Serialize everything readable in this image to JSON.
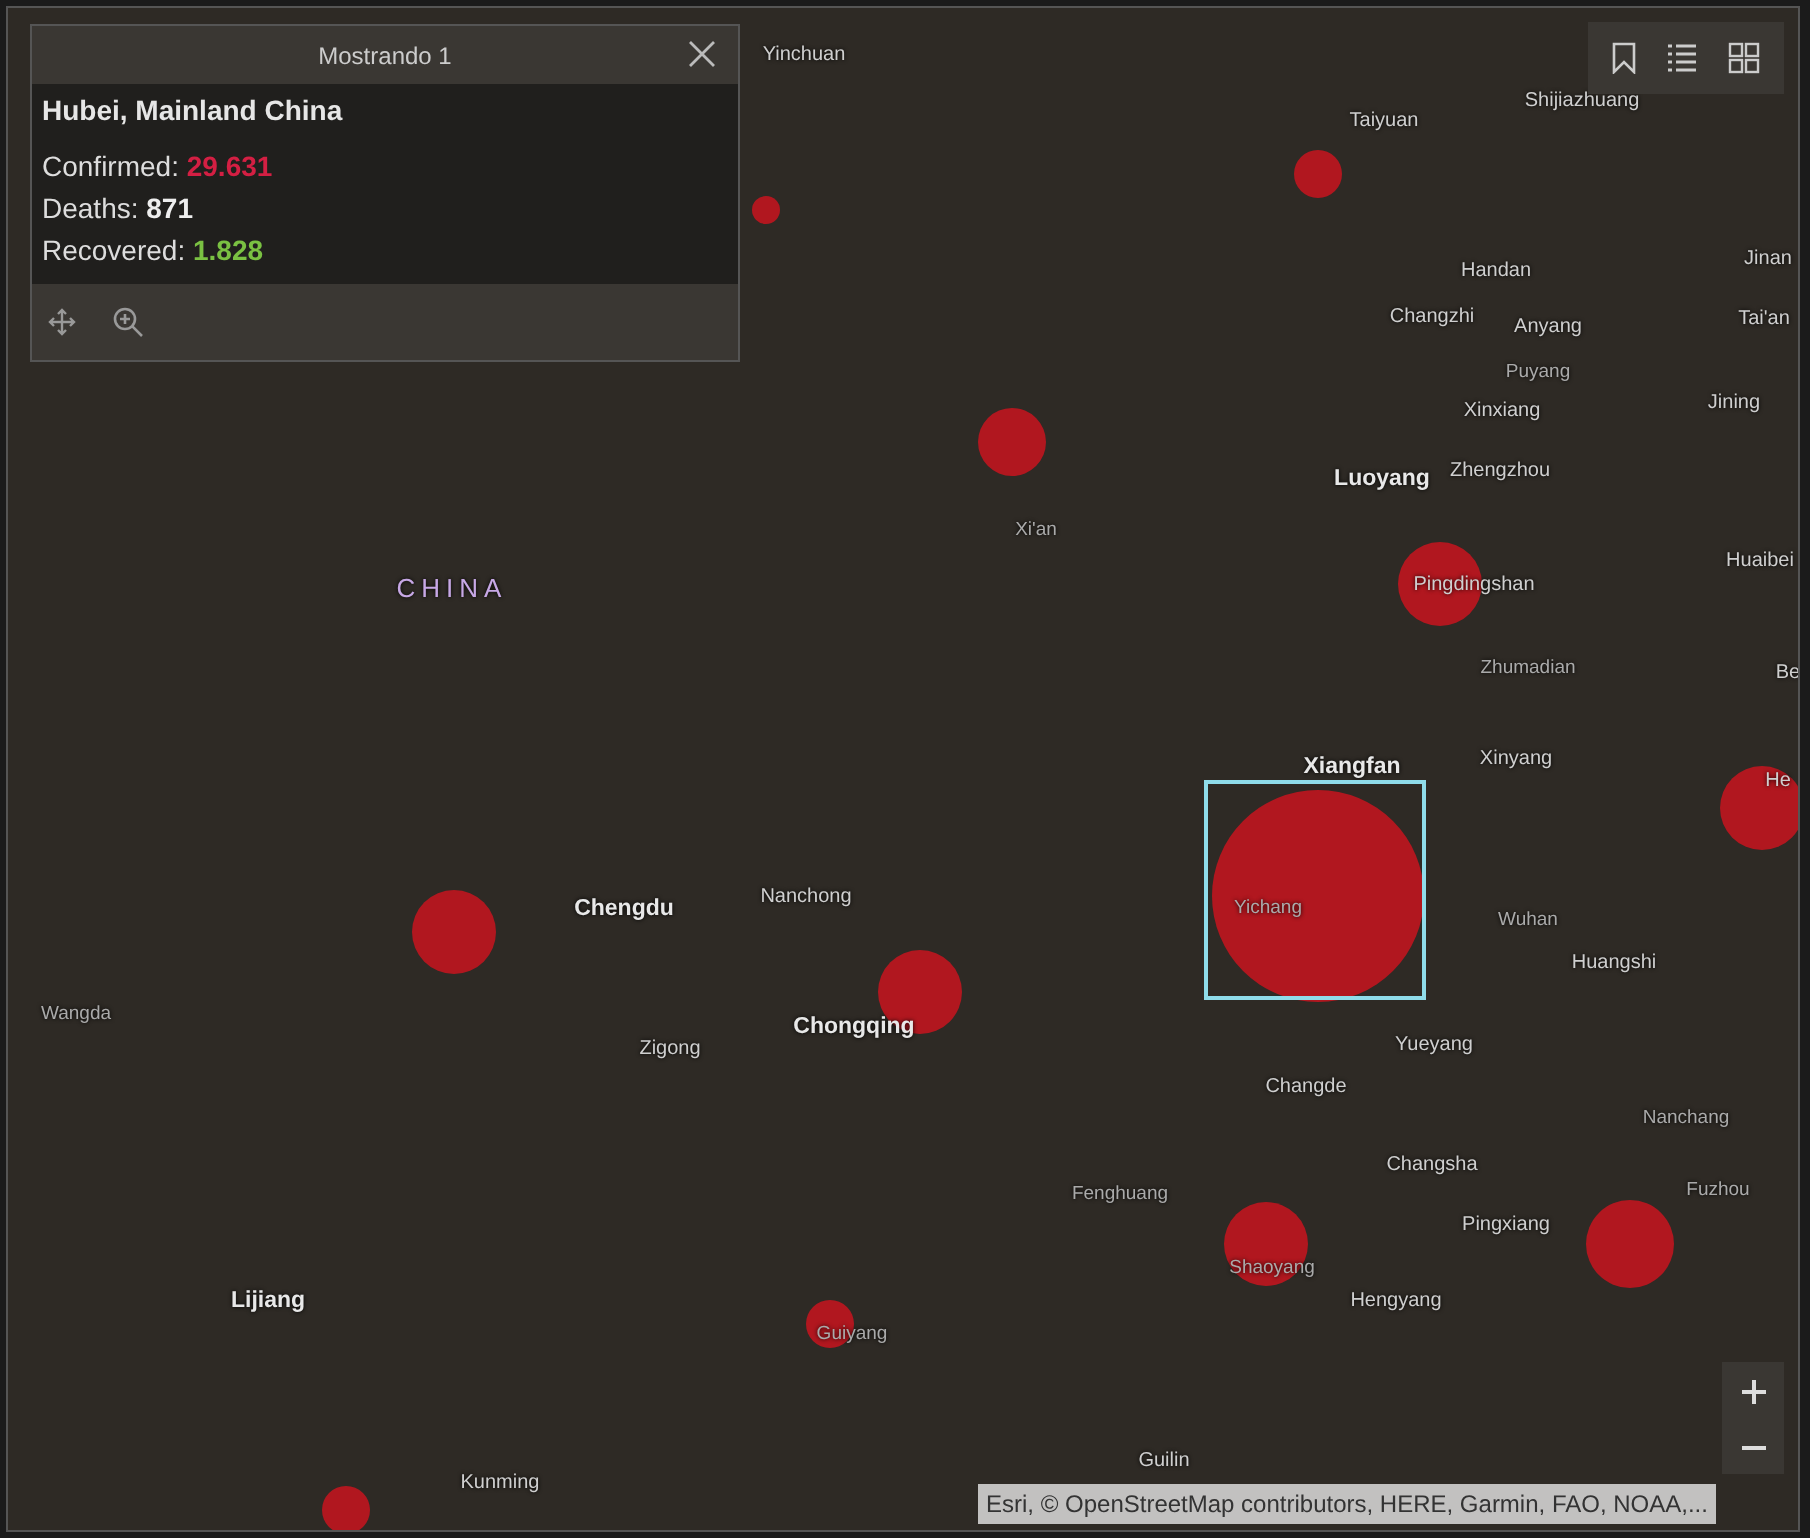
{
  "map": {
    "labels": [
      {
        "text": "Yinchuan",
        "kind": "city"
      },
      {
        "text": "Taiyuan",
        "kind": "city"
      },
      {
        "text": "Shijiazhuang",
        "kind": "city"
      },
      {
        "text": "Handan",
        "kind": "city"
      },
      {
        "text": "Jinan",
        "kind": "city"
      },
      {
        "text": "Changzhi",
        "kind": "city"
      },
      {
        "text": "Anyang",
        "kind": "city"
      },
      {
        "text": "Puyang",
        "kind": "town"
      },
      {
        "text": "Tai'an",
        "kind": "city"
      },
      {
        "text": "Xinxiang",
        "kind": "city"
      },
      {
        "text": "Jining",
        "kind": "city"
      },
      {
        "text": "Luoyang",
        "kind": "major"
      },
      {
        "text": "Zhengzhou",
        "kind": "city"
      },
      {
        "text": "Xi'an",
        "kind": "town"
      },
      {
        "text": "CHINA",
        "kind": "country"
      },
      {
        "text": "Pingdingshan",
        "kind": "city"
      },
      {
        "text": "Huaibei",
        "kind": "city"
      },
      {
        "text": "Zhumadian",
        "kind": "town"
      },
      {
        "text": "Be",
        "kind": "city"
      },
      {
        "text": "Xiangfan",
        "kind": "major"
      },
      {
        "text": "Xinyang",
        "kind": "city"
      },
      {
        "text": "He",
        "kind": "city"
      },
      {
        "text": "Yichang",
        "kind": "town"
      },
      {
        "text": "Wuhan",
        "kind": "town"
      },
      {
        "text": "Huangshi",
        "kind": "city"
      },
      {
        "text": "Chengdu",
        "kind": "major"
      },
      {
        "text": "Nanchong",
        "kind": "city"
      },
      {
        "text": "Chongqing",
        "kind": "major"
      },
      {
        "text": "Zigong",
        "kind": "city"
      },
      {
        "text": "Wangda",
        "kind": "town"
      },
      {
        "text": "Yueyang",
        "kind": "city"
      },
      {
        "text": "Changde",
        "kind": "city"
      },
      {
        "text": "Nanchang",
        "kind": "town"
      },
      {
        "text": "Fenghuang",
        "kind": "town"
      },
      {
        "text": "Changsha",
        "kind": "city"
      },
      {
        "text": "Fuzhou",
        "kind": "town"
      },
      {
        "text": "Pingxiang",
        "kind": "city"
      },
      {
        "text": "Shaoyang",
        "kind": "town"
      },
      {
        "text": "Hengyang",
        "kind": "city"
      },
      {
        "text": "Lijiang",
        "kind": "major"
      },
      {
        "text": "Guiyang",
        "kind": "town"
      },
      {
        "text": "Guilin",
        "kind": "city"
      },
      {
        "text": "Kunming",
        "kind": "city"
      }
    ]
  },
  "popup": {
    "header": "Mostrando 1",
    "title": "Hubei, Mainland China",
    "fields": [
      {
        "label": "Confirmed:",
        "value": "29.631",
        "color": "#d41f43"
      },
      {
        "label": "Deaths:",
        "value": "871",
        "color": "#eeeeee"
      },
      {
        "label": "Recovered:",
        "value": "1.828",
        "color": "#7ac142"
      }
    ]
  },
  "attribution": "Esri, © OpenStreetMap contributors, HERE, Garmin, FAO, NOAA,..."
}
